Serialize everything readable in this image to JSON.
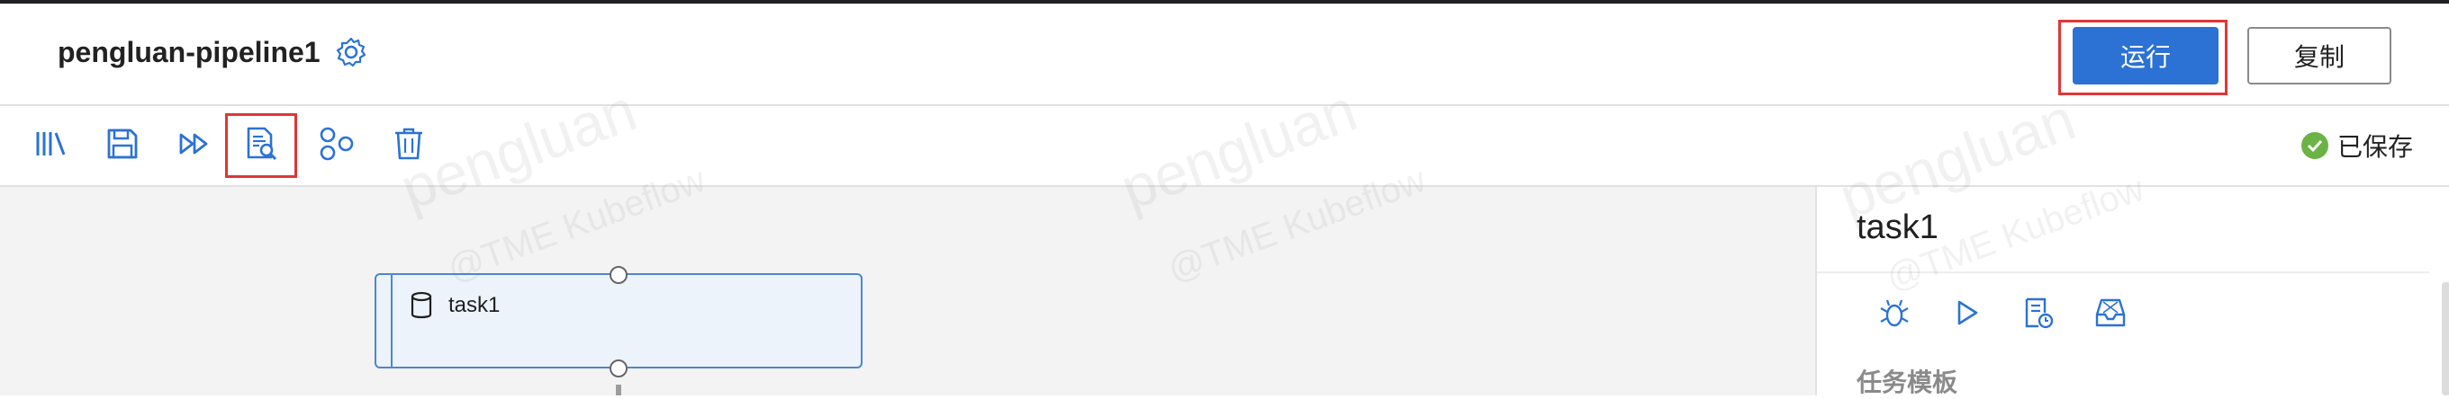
{
  "header": {
    "pipeline_title": "pengluan-pipeline1",
    "run_label": "运行",
    "copy_label": "复制"
  },
  "toolbar": {
    "icons": [
      "library-icon",
      "save-icon",
      "fast-forward-icon",
      "document-search-icon",
      "components-icon",
      "delete-icon"
    ],
    "status_text": "已保存"
  },
  "canvas": {
    "node": {
      "label": "task1",
      "icon": "database-icon"
    }
  },
  "panel": {
    "title": "task1",
    "icons": [
      "debug-icon",
      "play-icon",
      "log-schedule-icon",
      "inbox-icon"
    ],
    "section_label": "任务模板"
  },
  "watermark": {
    "line1": "pengluan",
    "line2": "@TME Kubeflow"
  },
  "colors": {
    "accent": "#2b72d4",
    "highlight": "#e03636",
    "saved": "#6cb346",
    "node_border": "#4c86d4",
    "node_fill": "#edf3fa"
  }
}
